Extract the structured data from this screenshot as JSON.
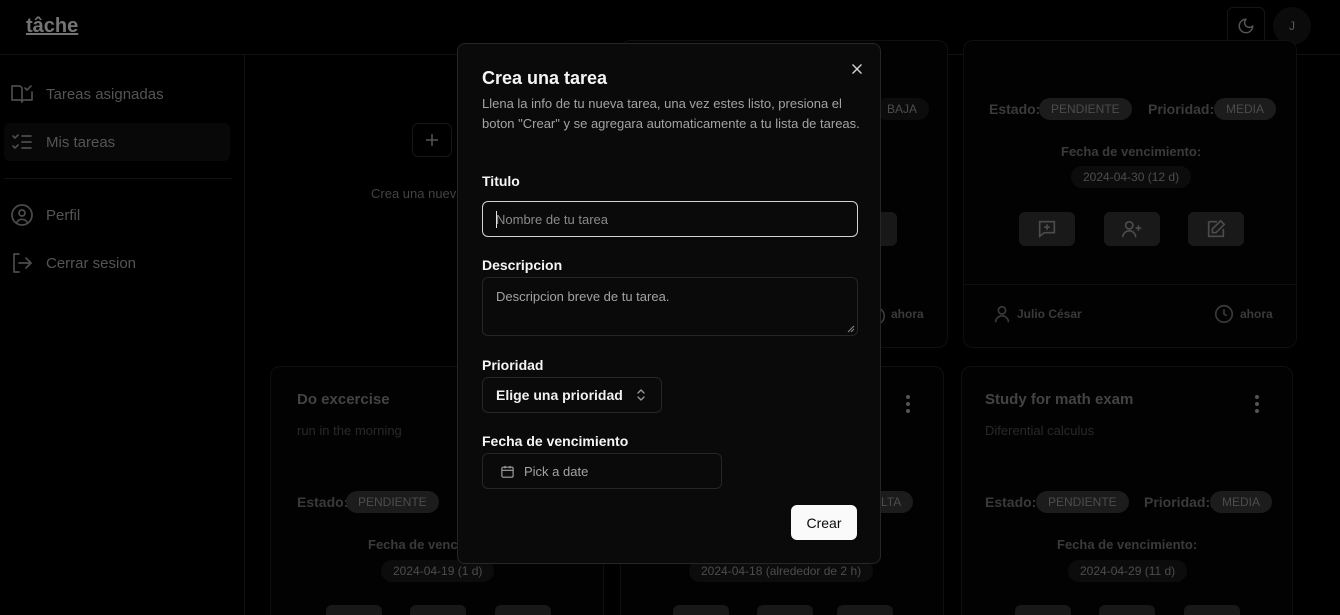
{
  "app": {
    "logo": "tâche",
    "avatar_initial": "J"
  },
  "sidebar": {
    "items": [
      {
        "label": "Tareas asignadas",
        "icon": "book-check-icon"
      },
      {
        "label": "Mis tareas",
        "icon": "list-checks-icon",
        "active": true
      },
      {
        "label": "Perfil",
        "icon": "user-circle-icon"
      },
      {
        "label": "Cerrar sesion",
        "icon": "log-out-icon"
      }
    ]
  },
  "background": {
    "create_card": {
      "label": "Crea una nueva tarea"
    },
    "labels": {
      "estado": "Estado:",
      "prioridad": "Prioridad:",
      "fecha": "Fecha de vencimiento:",
      "ahora": "ahora"
    },
    "top_cards": [
      {
        "priority": "BAJA"
      },
      {
        "status": "PENDIENTE",
        "priority": "MEDIA",
        "due": "2024-04-30 (12 d)",
        "user": "Julio César",
        "time": "ahora"
      }
    ],
    "bottom_cards": [
      {
        "title": "Do excercise",
        "description": "run in the morning",
        "status": "PENDIENTE",
        "due": "2024-04-19 (1 d)"
      },
      {
        "priority": "ALTA",
        "due": "2024-04-18 (alrededor de 2 h)"
      },
      {
        "title": "Study for math exam",
        "description": "Diferential calculus",
        "status": "PENDIENTE",
        "priority": "MEDIA",
        "due": "2024-04-29 (11 d)"
      }
    ]
  },
  "modal": {
    "title": "Crea una tarea",
    "description": "Llena la info de tu nueva tarea, una vez estes listo, presiona el boton \"Crear\" y se agregara automaticamente a tu lista de tareas.",
    "title_label": "Titulo",
    "title_placeholder": "Nombre de tu tarea",
    "description_label": "Descripcion",
    "description_placeholder": "Descripcion breve de tu tarea.",
    "priority_label": "Prioridad",
    "priority_value": "Elige una prioridad",
    "due_label": "Fecha de vencimiento",
    "due_placeholder": "Pick a date",
    "submit_label": "Crear"
  }
}
